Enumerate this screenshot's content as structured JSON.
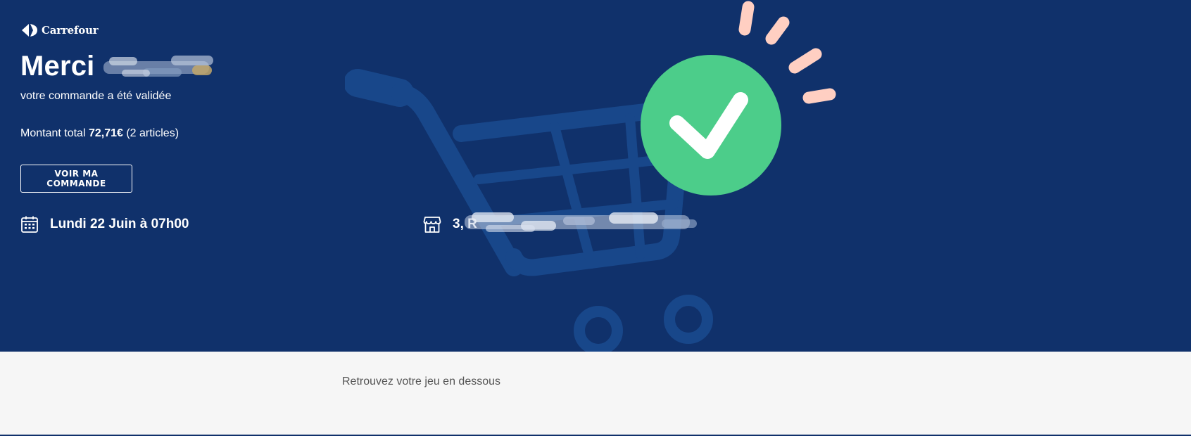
{
  "brand": {
    "name": "Carrefour"
  },
  "confirmation": {
    "title": "Merci",
    "subtitle": "votre commande a été validée",
    "total_label": "Montant total",
    "total_amount": "72,71€",
    "article_count": "(2 articles)",
    "view_order_button": "VOIR MA COMMANDE"
  },
  "delivery": {
    "slot_icon": "calendar-icon",
    "slot": "Lundi 22 Juin à 07h00",
    "store_icon": "store-icon",
    "store_address_visible": "3, R"
  },
  "game": {
    "caption": "Retrouvez votre jeu en dessous"
  },
  "colors": {
    "hero_background": "#10316b",
    "cart_illustration": "#18478a",
    "check_green": "#4ccd8a",
    "sparkle_pink": "#ffcfc2",
    "page_background": "#f6f6f6"
  }
}
